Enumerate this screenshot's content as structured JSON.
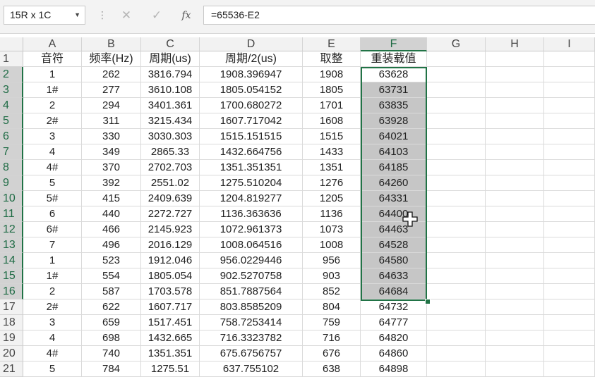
{
  "formula_bar": {
    "name_box": "15R x 1C",
    "cancel_icon": "✕",
    "enter_icon": "✓",
    "fx_label": "fx",
    "formula": "=65536-E2"
  },
  "columns": [
    "A",
    "B",
    "C",
    "D",
    "E",
    "F",
    "G",
    "H",
    "I"
  ],
  "header_row": [
    "音符",
    "频率(Hz)",
    "周期(us)",
    "周期/2(us)",
    "取整",
    "重装载值"
  ],
  "rows": [
    {
      "n": "1",
      "a": "",
      "b": "",
      "c": "",
      "d": "",
      "e": "",
      "f": ""
    },
    {
      "n": "2",
      "a": "1",
      "b": "262",
      "c": "3816.794",
      "d": "1908.396947",
      "e": "1908",
      "f": "63628"
    },
    {
      "n": "3",
      "a": "1#",
      "b": "277",
      "c": "3610.108",
      "d": "1805.054152",
      "e": "1805",
      "f": "63731"
    },
    {
      "n": "4",
      "a": "2",
      "b": "294",
      "c": "3401.361",
      "d": "1700.680272",
      "e": "1701",
      "f": "63835"
    },
    {
      "n": "5",
      "a": "2#",
      "b": "311",
      "c": "3215.434",
      "d": "1607.717042",
      "e": "1608",
      "f": "63928"
    },
    {
      "n": "6",
      "a": "3",
      "b": "330",
      "c": "3030.303",
      "d": "1515.151515",
      "e": "1515",
      "f": "64021"
    },
    {
      "n": "7",
      "a": "4",
      "b": "349",
      "c": "2865.33",
      "d": "1432.664756",
      "e": "1433",
      "f": "64103"
    },
    {
      "n": "8",
      "a": "4#",
      "b": "370",
      "c": "2702.703",
      "d": "1351.351351",
      "e": "1351",
      "f": "64185"
    },
    {
      "n": "9",
      "a": "5",
      "b": "392",
      "c": "2551.02",
      "d": "1275.510204",
      "e": "1276",
      "f": "64260"
    },
    {
      "n": "10",
      "a": "5#",
      "b": "415",
      "c": "2409.639",
      "d": "1204.819277",
      "e": "1205",
      "f": "64331"
    },
    {
      "n": "11",
      "a": "6",
      "b": "440",
      "c": "2272.727",
      "d": "1136.363636",
      "e": "1136",
      "f": "64400"
    },
    {
      "n": "12",
      "a": "6#",
      "b": "466",
      "c": "2145.923",
      "d": "1072.961373",
      "e": "1073",
      "f": "64463"
    },
    {
      "n": "13",
      "a": "7",
      "b": "496",
      "c": "2016.129",
      "d": "1008.064516",
      "e": "1008",
      "f": "64528"
    },
    {
      "n": "14",
      "a": "1",
      "b": "523",
      "c": "1912.046",
      "d": "956.0229446",
      "e": "956",
      "f": "64580"
    },
    {
      "n": "15",
      "a": "1#",
      "b": "554",
      "c": "1805.054",
      "d": "902.5270758",
      "e": "903",
      "f": "64633"
    },
    {
      "n": "16",
      "a": "2",
      "b": "587",
      "c": "1703.578",
      "d": "851.7887564",
      "e": "852",
      "f": "64684"
    },
    {
      "n": "17",
      "a": "2#",
      "b": "622",
      "c": "1607.717",
      "d": "803.8585209",
      "e": "804",
      "f": "64732"
    },
    {
      "n": "18",
      "a": "3",
      "b": "659",
      "c": "1517.451",
      "d": "758.7253414",
      "e": "759",
      "f": "64777"
    },
    {
      "n": "19",
      "a": "4",
      "b": "698",
      "c": "1432.665",
      "d": "716.3323782",
      "e": "716",
      "f": "64820"
    },
    {
      "n": "20",
      "a": "4#",
      "b": "740",
      "c": "1351.351",
      "d": "675.6756757",
      "e": "676",
      "f": "64860"
    },
    {
      "n": "21",
      "a": "5",
      "b": "784",
      "c": "1275.51",
      "d": "637.755102",
      "e": "638",
      "f": "64898"
    }
  ],
  "selection": {
    "column": "F",
    "first_row": 2,
    "last_row": 16
  },
  "colors": {
    "accent": "#217346",
    "selected_fill": "#c6c6c6",
    "header_fill": "#f2f2f2"
  }
}
